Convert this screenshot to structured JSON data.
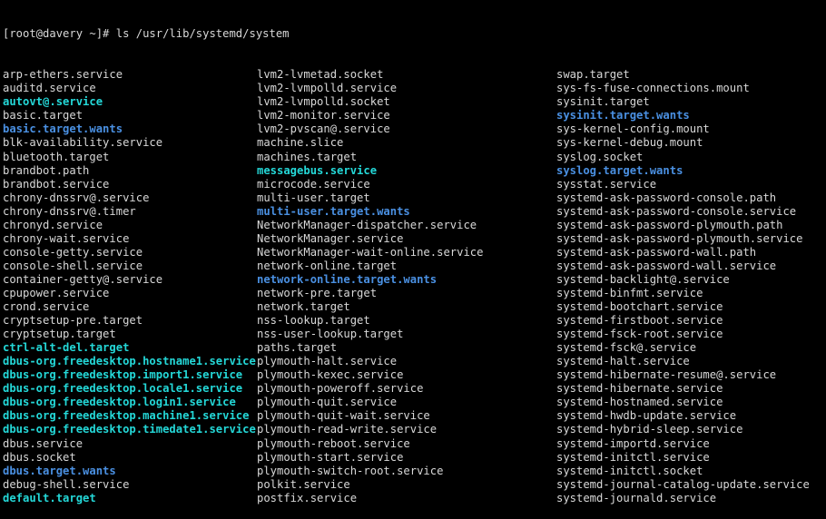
{
  "terminal": {
    "background_color": "#000000",
    "foreground_color": "#d8d8d8",
    "symlink_color": "#24d8d8",
    "directory_color": "#4a90e2",
    "prompt": "[root@davery ~]# ls /usr/lib/systemd/system"
  },
  "listing": {
    "columns": 3,
    "rows": [
      [
        {
          "name": "arp-ethers.service",
          "type": "file"
        },
        {
          "name": "lvm2-lvmetad.socket",
          "type": "file"
        },
        {
          "name": "swap.target",
          "type": "file"
        }
      ],
      [
        {
          "name": "auditd.service",
          "type": "file"
        },
        {
          "name": "lvm2-lvmpolld.service",
          "type": "file"
        },
        {
          "name": "sys-fs-fuse-connections.mount",
          "type": "file"
        }
      ],
      [
        {
          "name": "autovt@.service",
          "type": "link"
        },
        {
          "name": "lvm2-lvmpolld.socket",
          "type": "file"
        },
        {
          "name": "sysinit.target",
          "type": "file"
        }
      ],
      [
        {
          "name": "basic.target",
          "type": "file"
        },
        {
          "name": "lvm2-monitor.service",
          "type": "file"
        },
        {
          "name": "sysinit.target.wants",
          "type": "dir"
        }
      ],
      [
        {
          "name": "basic.target.wants",
          "type": "dir"
        },
        {
          "name": "lvm2-pvscan@.service",
          "type": "file"
        },
        {
          "name": "sys-kernel-config.mount",
          "type": "file"
        }
      ],
      [
        {
          "name": "blk-availability.service",
          "type": "file"
        },
        {
          "name": "machine.slice",
          "type": "file"
        },
        {
          "name": "sys-kernel-debug.mount",
          "type": "file"
        }
      ],
      [
        {
          "name": "bluetooth.target",
          "type": "file"
        },
        {
          "name": "machines.target",
          "type": "file"
        },
        {
          "name": "syslog.socket",
          "type": "file"
        }
      ],
      [
        {
          "name": "brandbot.path",
          "type": "file"
        },
        {
          "name": "messagebus.service",
          "type": "link"
        },
        {
          "name": "syslog.target.wants",
          "type": "dir"
        }
      ],
      [
        {
          "name": "brandbot.service",
          "type": "file"
        },
        {
          "name": "microcode.service",
          "type": "file"
        },
        {
          "name": "sysstat.service",
          "type": "file"
        }
      ],
      [
        {
          "name": "chrony-dnssrv@.service",
          "type": "file"
        },
        {
          "name": "multi-user.target",
          "type": "file"
        },
        {
          "name": "systemd-ask-password-console.path",
          "type": "file"
        }
      ],
      [
        {
          "name": "chrony-dnssrv@.timer",
          "type": "file"
        },
        {
          "name": "multi-user.target.wants",
          "type": "dir"
        },
        {
          "name": "systemd-ask-password-console.service",
          "type": "file"
        }
      ],
      [
        {
          "name": "chronyd.service",
          "type": "file"
        },
        {
          "name": "NetworkManager-dispatcher.service",
          "type": "file"
        },
        {
          "name": "systemd-ask-password-plymouth.path",
          "type": "file"
        }
      ],
      [
        {
          "name": "chrony-wait.service",
          "type": "file"
        },
        {
          "name": "NetworkManager.service",
          "type": "file"
        },
        {
          "name": "systemd-ask-password-plymouth.service",
          "type": "file"
        }
      ],
      [
        {
          "name": "console-getty.service",
          "type": "file"
        },
        {
          "name": "NetworkManager-wait-online.service",
          "type": "file"
        },
        {
          "name": "systemd-ask-password-wall.path",
          "type": "file"
        }
      ],
      [
        {
          "name": "console-shell.service",
          "type": "file"
        },
        {
          "name": "network-online.target",
          "type": "file"
        },
        {
          "name": "systemd-ask-password-wall.service",
          "type": "file"
        }
      ],
      [
        {
          "name": "container-getty@.service",
          "type": "file"
        },
        {
          "name": "network-online.target.wants",
          "type": "dir"
        },
        {
          "name": "systemd-backlight@.service",
          "type": "file"
        }
      ],
      [
        {
          "name": "cpupower.service",
          "type": "file"
        },
        {
          "name": "network-pre.target",
          "type": "file"
        },
        {
          "name": "systemd-binfmt.service",
          "type": "file"
        }
      ],
      [
        {
          "name": "crond.service",
          "type": "file"
        },
        {
          "name": "network.target",
          "type": "file"
        },
        {
          "name": "systemd-bootchart.service",
          "type": "file"
        }
      ],
      [
        {
          "name": "cryptsetup-pre.target",
          "type": "file"
        },
        {
          "name": "nss-lookup.target",
          "type": "file"
        },
        {
          "name": "systemd-firstboot.service",
          "type": "file"
        }
      ],
      [
        {
          "name": "cryptsetup.target",
          "type": "file"
        },
        {
          "name": "nss-user-lookup.target",
          "type": "file"
        },
        {
          "name": "systemd-fsck-root.service",
          "type": "file"
        }
      ],
      [
        {
          "name": "ctrl-alt-del.target",
          "type": "link"
        },
        {
          "name": "paths.target",
          "type": "file"
        },
        {
          "name": "systemd-fsck@.service",
          "type": "file"
        }
      ],
      [
        {
          "name": "dbus-org.freedesktop.hostname1.service",
          "type": "link"
        },
        {
          "name": "plymouth-halt.service",
          "type": "file"
        },
        {
          "name": "systemd-halt.service",
          "type": "file"
        }
      ],
      [
        {
          "name": "dbus-org.freedesktop.import1.service",
          "type": "link"
        },
        {
          "name": "plymouth-kexec.service",
          "type": "file"
        },
        {
          "name": "systemd-hibernate-resume@.service",
          "type": "file"
        }
      ],
      [
        {
          "name": "dbus-org.freedesktop.locale1.service",
          "type": "link"
        },
        {
          "name": "plymouth-poweroff.service",
          "type": "file"
        },
        {
          "name": "systemd-hibernate.service",
          "type": "file"
        }
      ],
      [
        {
          "name": "dbus-org.freedesktop.login1.service",
          "type": "link"
        },
        {
          "name": "plymouth-quit.service",
          "type": "file"
        },
        {
          "name": "systemd-hostnamed.service",
          "type": "file"
        }
      ],
      [
        {
          "name": "dbus-org.freedesktop.machine1.service",
          "type": "link"
        },
        {
          "name": "plymouth-quit-wait.service",
          "type": "file"
        },
        {
          "name": "systemd-hwdb-update.service",
          "type": "file"
        }
      ],
      [
        {
          "name": "dbus-org.freedesktop.timedate1.service",
          "type": "link"
        },
        {
          "name": "plymouth-read-write.service",
          "type": "file"
        },
        {
          "name": "systemd-hybrid-sleep.service",
          "type": "file"
        }
      ],
      [
        {
          "name": "dbus.service",
          "type": "file"
        },
        {
          "name": "plymouth-reboot.service",
          "type": "file"
        },
        {
          "name": "systemd-importd.service",
          "type": "file"
        }
      ],
      [
        {
          "name": "dbus.socket",
          "type": "file"
        },
        {
          "name": "plymouth-start.service",
          "type": "file"
        },
        {
          "name": "systemd-initctl.service",
          "type": "file"
        }
      ],
      [
        {
          "name": "dbus.target.wants",
          "type": "dir"
        },
        {
          "name": "plymouth-switch-root.service",
          "type": "file"
        },
        {
          "name": "systemd-initctl.socket",
          "type": "file"
        }
      ],
      [
        {
          "name": "debug-shell.service",
          "type": "file"
        },
        {
          "name": "polkit.service",
          "type": "file"
        },
        {
          "name": "systemd-journal-catalog-update.service",
          "type": "file"
        }
      ],
      [
        {
          "name": "default.target",
          "type": "link"
        },
        {
          "name": "postfix.service",
          "type": "file"
        },
        {
          "name": "systemd-journald.service",
          "type": "file"
        }
      ]
    ]
  }
}
